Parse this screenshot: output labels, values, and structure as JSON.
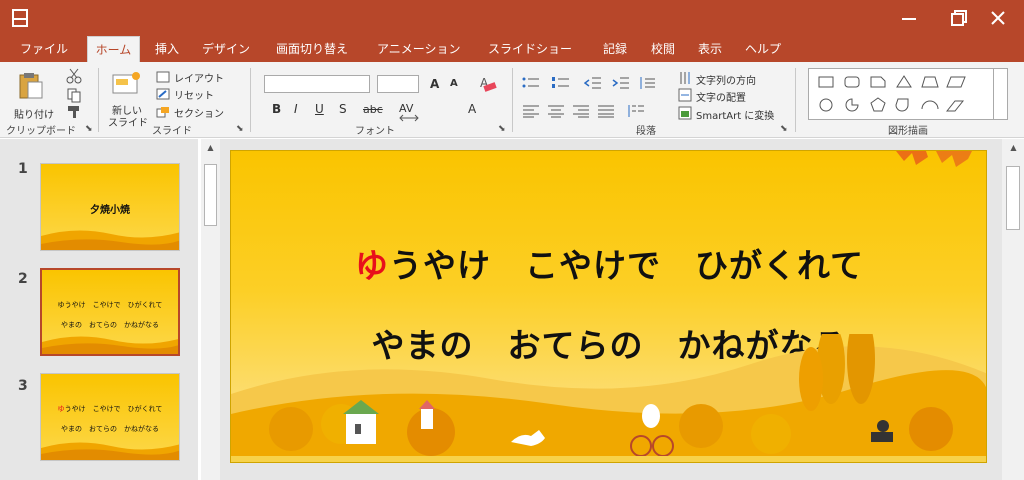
{
  "app": {
    "tabs": [
      "ファイル",
      "ホーム",
      "挿入",
      "デザイン",
      "画面切り替え",
      "アニメーション",
      "スライドショー",
      "記録",
      "校閲",
      "表示",
      "ヘルプ"
    ],
    "active_tab": "ホーム"
  },
  "ribbon": {
    "clipboard": {
      "paste_label": "貼り付け",
      "group_label": "クリップボード"
    },
    "slides": {
      "new_slide_label_1": "新しい",
      "new_slide_label_2": "スライド",
      "layout_label": "レイアウト",
      "reset_label": "リセット",
      "section_label": "セクション",
      "group_label": "スライド"
    },
    "font": {
      "group_label": "フォント",
      "grow_label": "A",
      "shrink_label": "A",
      "clear_label": "A",
      "bold_label": "B",
      "italic_label": "I",
      "underline_label": "U",
      "shadow_label": "S",
      "strike_label": "abc",
      "spacing_label": "AV",
      "color_label": "A"
    },
    "paragraph": {
      "group_label": "段落",
      "text_direction_label": "文字列の方向",
      "align_text_label": "文字の配置",
      "smartart_label": "SmartArt に変換"
    },
    "drawing": {
      "group_label": "図形描画"
    }
  },
  "thumbnails": [
    {
      "number": "1",
      "lines": [
        "夕焼小焼"
      ],
      "selected": false
    },
    {
      "number": "2",
      "lines": [
        "ゆうやけ　こやけで　ひがくれて",
        "やまの　おてらの　かねがなる"
      ],
      "selected": true
    },
    {
      "number": "3",
      "lines": [
        "ゆうやけ　こやけで　ひがくれて",
        "やまの　おてらの　かねがなる"
      ],
      "selected": false
    }
  ],
  "slide": {
    "line1_first": "ゆ",
    "line1_rest": "うやけ　こやけで　ひがくれて",
    "line2": "やまの　おてらの　かねがなる"
  },
  "colors": {
    "accent": "#b7472a",
    "highlight_char": "#e8101b",
    "slide_bg": "#fac400"
  }
}
